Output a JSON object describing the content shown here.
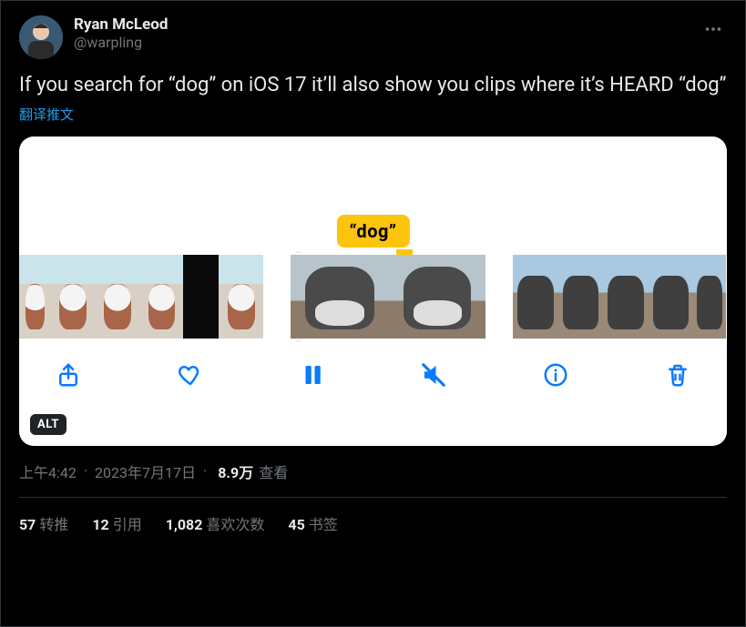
{
  "author": {
    "name": "Ryan McLeod",
    "handle": "@warpling"
  },
  "tweet_text": "If you search for “dog” on iOS 17 it’ll also show you clips where it’s HEARD “dog”",
  "translate_label": "翻译推文",
  "tooltip_text": "“dog”",
  "alt_badge": "ALT",
  "meta": {
    "time": "上午4:42",
    "date": "2023年7月17日",
    "views_number": "8.9万",
    "views_label": "查看"
  },
  "stats": {
    "retweets_n": "57",
    "retweets_label": "转推",
    "quotes_n": "12",
    "quotes_label": "引用",
    "likes_n": "1,082",
    "likes_label": "喜欢次数",
    "bookmarks_n": "45",
    "bookmarks_label": "书签"
  }
}
